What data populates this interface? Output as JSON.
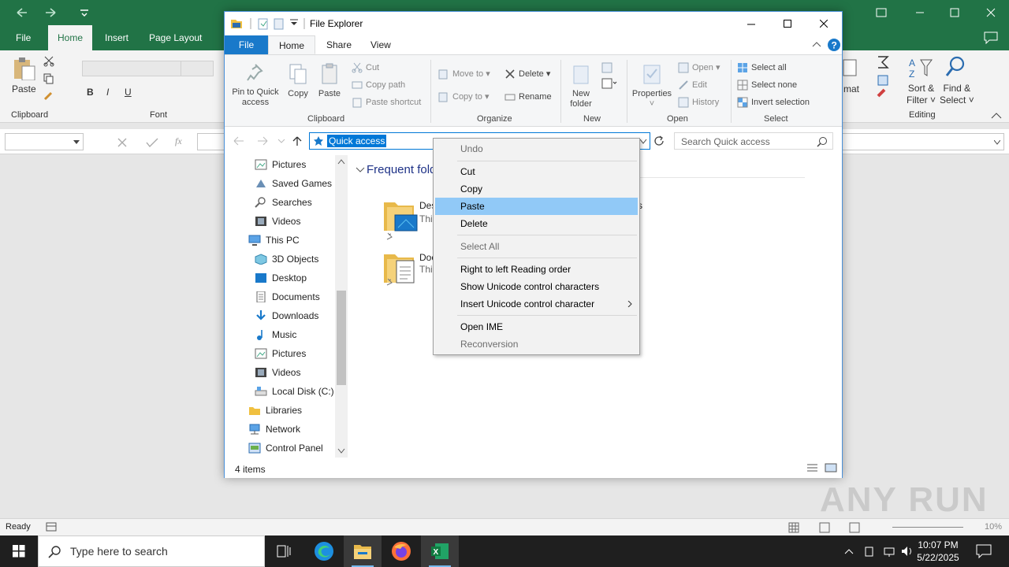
{
  "excel": {
    "tabs": [
      "File",
      "Home",
      "Insert",
      "Page Layout"
    ],
    "active_tab": "Home",
    "ribbon": {
      "paste": "Paste",
      "clipboard": "Clipboard",
      "font": "Font",
      "format_partial": "mat",
      "sort_filter_1": "Sort &",
      "sort_filter_2": "Filter",
      "find_select_1": "Find &",
      "find_select_2": "Select",
      "editing": "Editing",
      "bold": "B",
      "italic": "I",
      "underline": "U",
      "fx": "fx"
    },
    "status": {
      "ready": "Ready",
      "zoom": "10%"
    },
    "accent": "#217346"
  },
  "explorer": {
    "title": "File Explorer",
    "tabs": {
      "file": "File",
      "home": "Home",
      "share": "Share",
      "view": "View"
    },
    "ribbon": {
      "pin": "Pin to Quick access",
      "copy": "Copy",
      "paste": "Paste",
      "cut": "Cut",
      "copy_path": "Copy path",
      "paste_shortcut": "Paste shortcut",
      "clipboard": "Clipboard",
      "move_to": "Move to",
      "copy_to": "Copy to",
      "delete": "Delete",
      "rename": "Rename",
      "organize": "Organize",
      "new_folder": "New folder",
      "new": "New",
      "properties": "Properties",
      "open": "Open",
      "edit": "Edit",
      "history": "History",
      "open_group": "Open",
      "select_all": "Select all",
      "select_none": "Select none",
      "invert_selection": "Invert selection",
      "select_group": "Select"
    },
    "address": {
      "value": "Quick access"
    },
    "search": {
      "placeholder": "Search Quick access"
    },
    "nav": [
      {
        "label": "Pictures",
        "icon": "pictures-icon"
      },
      {
        "label": "Saved Games",
        "icon": "saved-games-icon"
      },
      {
        "label": "Searches",
        "icon": "searches-icon"
      },
      {
        "label": "Videos",
        "icon": "videos-icon"
      },
      {
        "label": "This PC",
        "icon": "this-pc-icon"
      },
      {
        "label": "3D Objects",
        "icon": "3d-objects-icon"
      },
      {
        "label": "Desktop",
        "icon": "desktop-icon"
      },
      {
        "label": "Documents",
        "icon": "documents-icon"
      },
      {
        "label": "Downloads",
        "icon": "downloads-icon"
      },
      {
        "label": "Music",
        "icon": "music-icon"
      },
      {
        "label": "Pictures",
        "icon": "pictures-icon"
      },
      {
        "label": "Videos",
        "icon": "videos-icon"
      },
      {
        "label": "Local Disk (C:)",
        "icon": "local-disk-icon"
      },
      {
        "label": "Libraries",
        "icon": "libraries-icon"
      },
      {
        "label": "Network",
        "icon": "network-icon"
      },
      {
        "label": "Control Panel",
        "icon": "control-panel-icon"
      }
    ],
    "content": {
      "section": "Frequent fold",
      "tiles": [
        {
          "name": "Des",
          "sub": "Thi"
        },
        {
          "name": "Doc",
          "sub": "Thi"
        }
      ],
      "partial_right": "s"
    },
    "status": "4 items"
  },
  "context_menu": {
    "items": [
      {
        "label": "Undo",
        "disabled": true
      },
      {
        "label": "Cut",
        "disabled": false
      },
      {
        "label": "Copy",
        "disabled": false
      },
      {
        "label": "Paste",
        "disabled": false,
        "highlighted": true
      },
      {
        "label": "Delete",
        "disabled": false
      },
      {
        "label": "Select All",
        "disabled": true
      },
      {
        "label": "Right to left Reading order",
        "disabled": false
      },
      {
        "label": "Show Unicode control characters",
        "disabled": false
      },
      {
        "label": "Insert Unicode control character",
        "disabled": false,
        "submenu": true
      },
      {
        "label": "Open IME",
        "disabled": false
      },
      {
        "label": "Reconversion",
        "disabled": true
      }
    ]
  },
  "taskbar": {
    "search_placeholder": "Type here to search",
    "time": "10:07 PM",
    "date": "5/22/2025"
  },
  "watermark": "ANY RUN"
}
